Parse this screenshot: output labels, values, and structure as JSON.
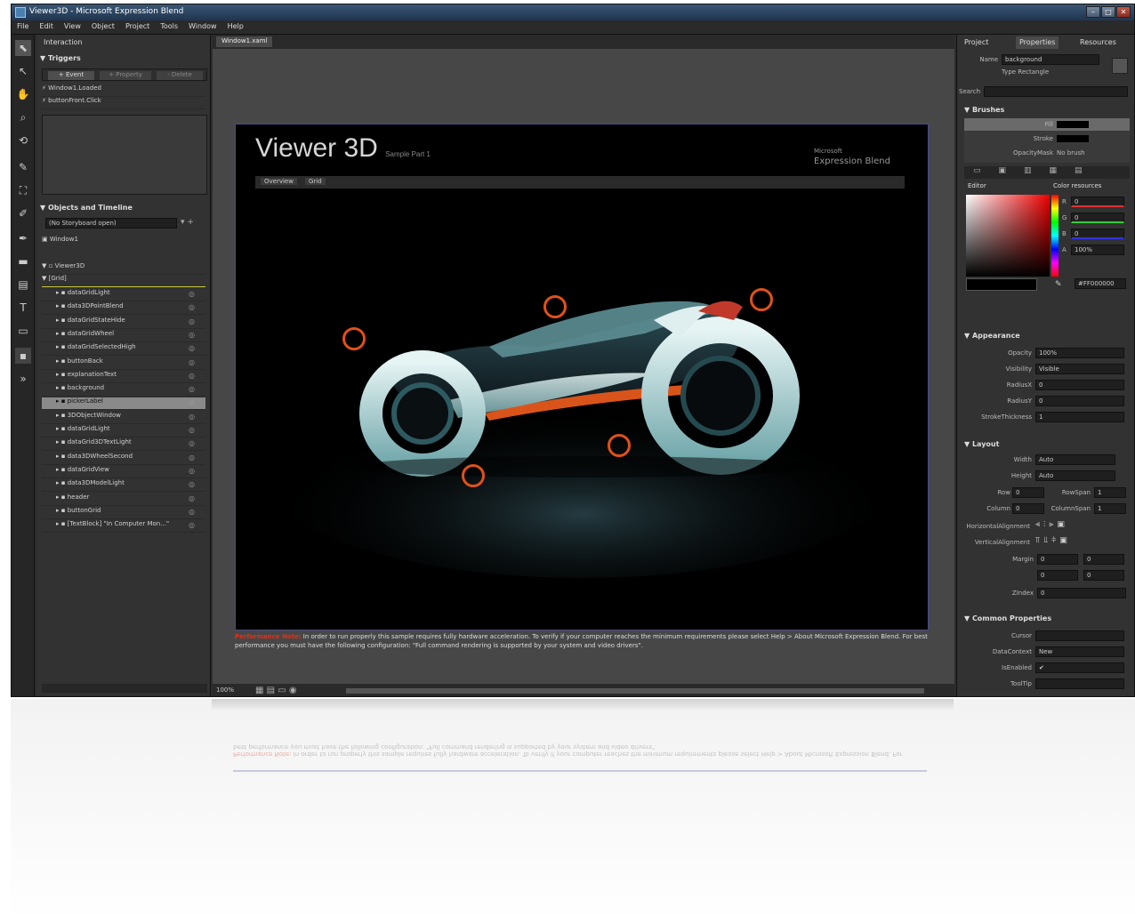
{
  "window": {
    "title": "Viewer3D - Microsoft Expression Blend",
    "controls": [
      "–",
      "□",
      "✕"
    ]
  },
  "menu": [
    "File",
    "Edit",
    "View",
    "Object",
    "Project",
    "Tools",
    "Window",
    "Help"
  ],
  "left_panel": {
    "tab": "Interaction",
    "triggers_header": "Triggers",
    "trigger_buttons": [
      "+ Event",
      "+ Property",
      "- Delete"
    ],
    "triggers": [
      "Window1.Loaded",
      "buttonFront.Click"
    ],
    "objects_header": "Objects and Timeline",
    "timeline_name": "(No Storyboard open)",
    "root": "Viewer3D",
    "layout_root": "[Grid]",
    "objects": [
      "dataGridLight",
      "data3DPointBlend",
      "dataGridStateHide",
      "dataGridWheel",
      "dataGridSelectedHigh",
      "buttonBack",
      "explanationText",
      "background",
      "pickerLabel",
      "3DObjectWindow",
      "dataGridLight",
      "dataGrid3DTextLight",
      "data3DWheelSecond",
      "dataGridView",
      "data3DModelLight",
      "header",
      "buttonGrid",
      "[TextBlock] \"In Computer Mon...\""
    ]
  },
  "document": {
    "tab": "Window1.xaml",
    "app_title": "Viewer 3D",
    "app_subtitle": "Sample Part 1",
    "brand_line1": "Microsoft",
    "brand_line2": "Expression Blend",
    "buttons": [
      "Overview",
      "Grid"
    ],
    "warning_label": "Performance Note:",
    "warning_text": "In order to run properly this sample requires fully hardware acceleration. To verify if your computer reaches the minimum requirements please select Help > About Microsoft Expression Blend. For best performance you must have the following configuration: \"Full command rendering is supported by your system and video drivers\".",
    "zoom": "100%"
  },
  "right_panel": {
    "tabs": [
      "Project",
      "Properties",
      "Resources"
    ],
    "name_label": "Name",
    "name_value": "background",
    "type_value": "Type  Rectangle",
    "search_label": "Search",
    "brushes_header": "Brushes",
    "brush_rows": [
      "Fill",
      "Stroke",
      "OpacityMask"
    ],
    "opacitymask_value": "No brush",
    "editor_tabs": [
      "Editor",
      "Color resources"
    ],
    "rgb": {
      "R": "0",
      "G": "0",
      "B": "0",
      "A": "100%"
    },
    "hex": "#FF000000",
    "appearance_header": "Appearance",
    "appearance": [
      {
        "label": "Opacity",
        "value": "100%"
      },
      {
        "label": "Visibility",
        "value": "Visible"
      },
      {
        "label": "RadiusX",
        "value": "0"
      },
      {
        "label": "RadiusY",
        "value": "0"
      },
      {
        "label": "StrokeThickness",
        "value": "1"
      }
    ],
    "layout_header": "Layout",
    "layout": [
      {
        "label": "Width",
        "value": "Auto"
      },
      {
        "label": "Height",
        "value": "Auto"
      }
    ],
    "grid": [
      {
        "label": "Row",
        "value": "0",
        "label2": "RowSpan",
        "value2": "1"
      },
      {
        "label": "Column",
        "value": "0",
        "label2": "ColumnSpan",
        "value2": "1"
      }
    ],
    "align_labels": [
      "HorizontalAlignment",
      "VerticalAlignment"
    ],
    "margin_label": "Margin",
    "margin_values": [
      "0",
      "0",
      "0",
      "0"
    ],
    "zindex_label": "ZIndex",
    "zindex_value": "0",
    "common_header": "Common Properties",
    "common": [
      {
        "label": "Cursor",
        "value": ""
      },
      {
        "label": "DataContext",
        "value": "New"
      },
      {
        "label": "IsEnabled",
        "value": "✔"
      },
      {
        "label": "ToolTip",
        "value": ""
      }
    ]
  },
  "colors": {
    "accent_hotspot": "#e0511a",
    "warning": "#e0301a",
    "bike_cyan": "#9fd6d8",
    "bike_orange": "#d9541a"
  }
}
